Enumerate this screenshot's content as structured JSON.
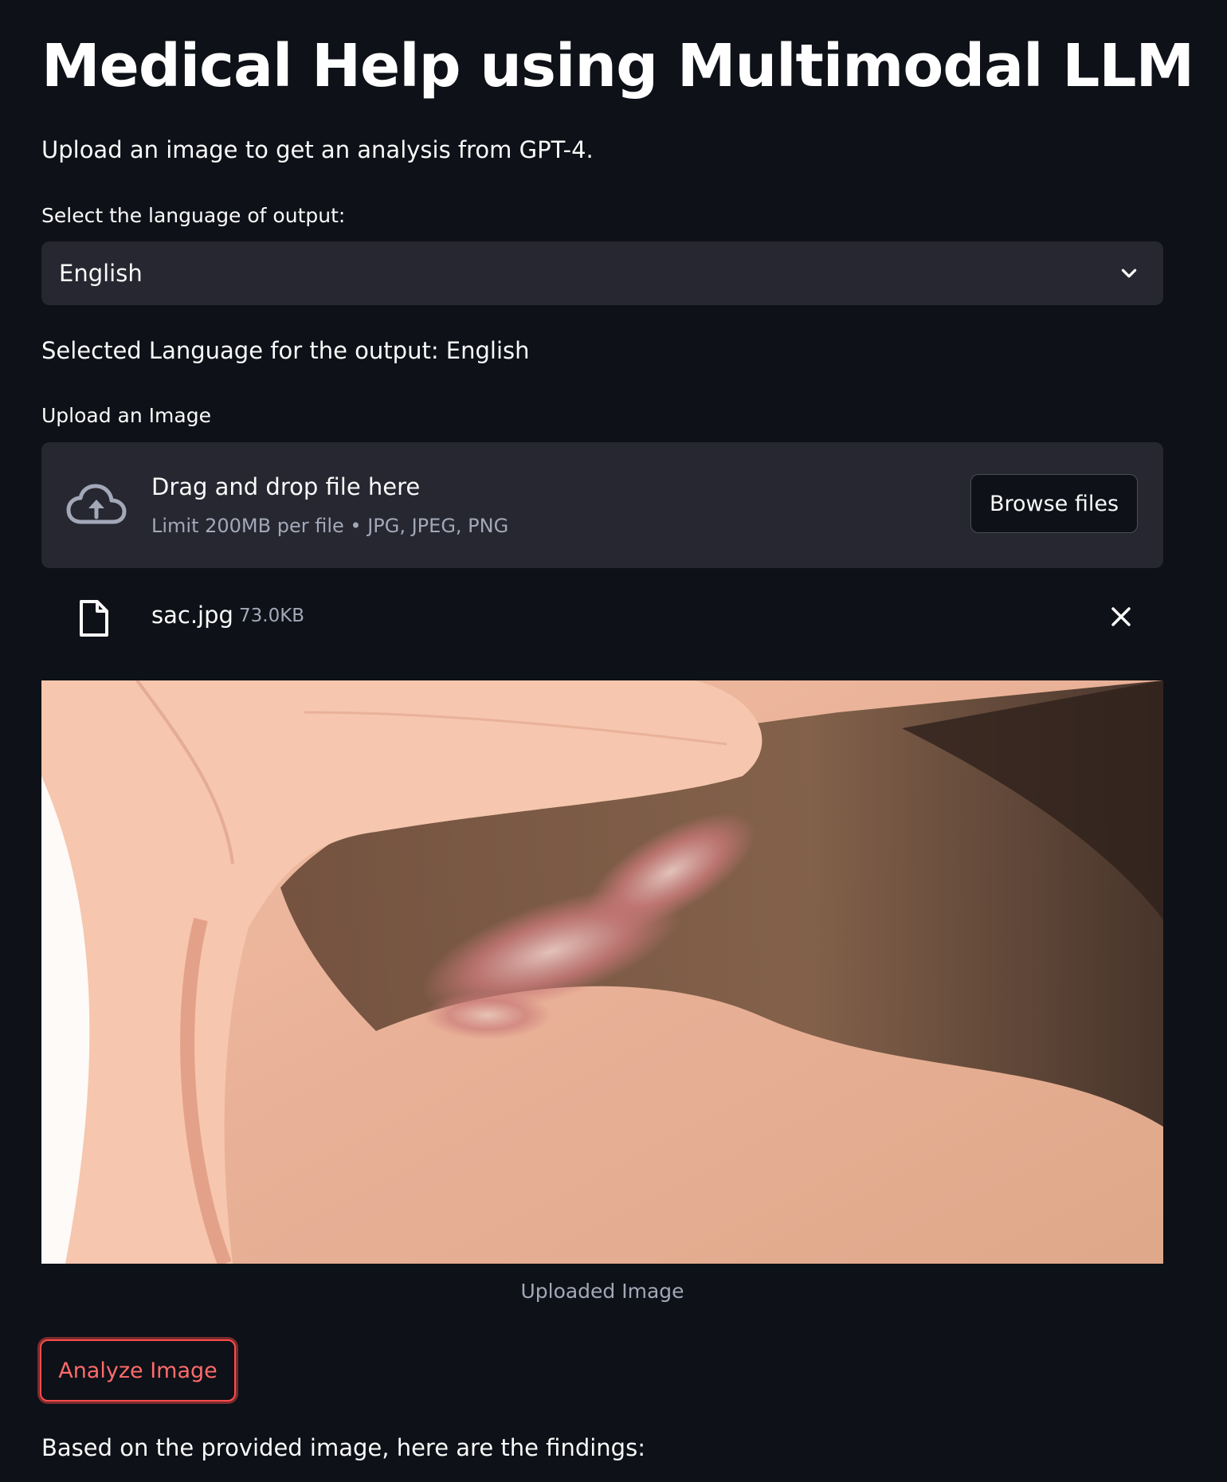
{
  "page": {
    "title": "Medical Help using Multimodal LLM",
    "subtitle": "Upload an image to get an analysis from GPT-4."
  },
  "language": {
    "label": "Select the language of output:",
    "selected": "English",
    "status": "Selected Language for the output: English"
  },
  "uploader": {
    "label": "Upload an Image",
    "drop_title": "Drag and drop file here",
    "limit_text": "Limit 200MB per file • JPG, JPEG, PNG",
    "browse_label": "Browse files",
    "file": {
      "name": "sac.jpg",
      "size": "73.0KB"
    }
  },
  "image": {
    "caption": "Uploaded Image"
  },
  "actions": {
    "analyze_label": "Analyze Image"
  },
  "results": {
    "intro": "Based on the provided image, here are the findings:"
  },
  "colors": {
    "background": "#0e1117",
    "surface": "#262730",
    "accent": "#ff4b4b",
    "muted_text": "#a3a8b8"
  },
  "icons": {
    "select": "chevron-down-icon",
    "upload": "cloud-upload-icon",
    "file": "file-icon",
    "remove": "close-icon"
  }
}
